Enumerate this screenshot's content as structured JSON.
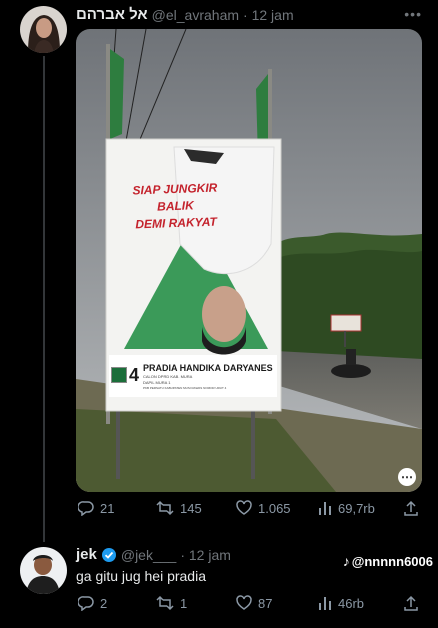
{
  "tweet": {
    "author_name": "אל אברהם",
    "handle": "@el_avraham",
    "time": "· 12 jam",
    "more_icon": "more-dots-icon",
    "media": {
      "billboard_text_line1": "SIAP JUNGKIR BALIK",
      "billboard_text_line2": "DEMI RAKYAT",
      "candidate_number": "4",
      "candidate_name": "PRADIA HANDIKA DARYANES",
      "candidate_sub1": "CALON DPRD KAB. MURA",
      "candidate_sub2": "DAPIL MURA 1",
      "candidate_sub3": "PKB PERSATU KABUPATEN MUSI RAWAS NOMOR URUT 4"
    },
    "actions": {
      "replies": "21",
      "retweets": "145",
      "likes": "1.065",
      "views": "69,7rb"
    }
  },
  "reply": {
    "author_name": "jek",
    "handle": "@jek___",
    "time": "· 12 jam",
    "text": "ga gitu jug hei pradia",
    "actions": {
      "replies": "2",
      "retweets": "1",
      "likes": "87",
      "views": "46rb"
    }
  },
  "watermark": {
    "handle": "@nnnnn6006"
  },
  "colors": {
    "background": "#000000",
    "muted": "#71767b",
    "verified": "#1d9bf0"
  }
}
